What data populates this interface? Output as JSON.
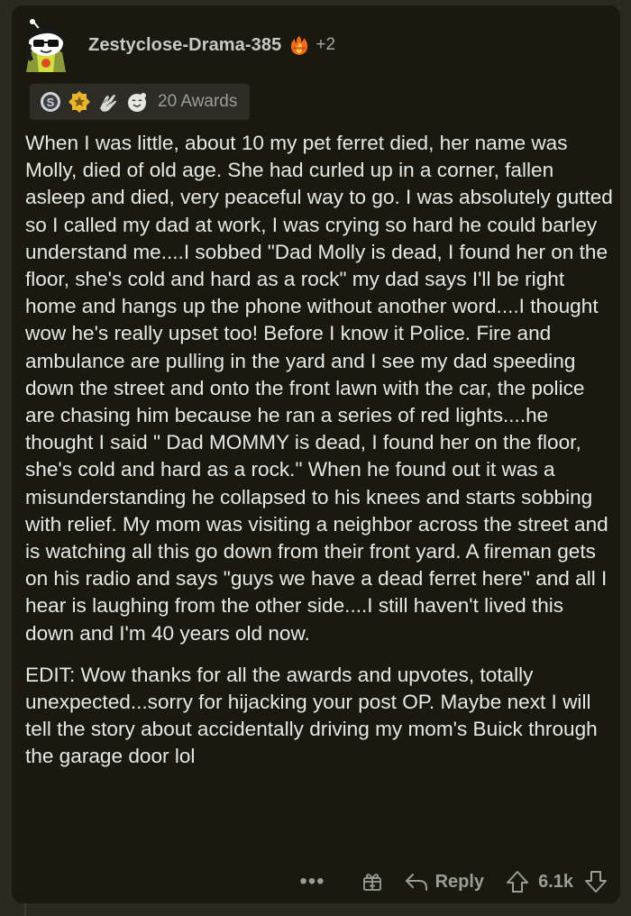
{
  "comment": {
    "username": "Zestyclose-Drama-385",
    "flair_icon": "fire-award-icon",
    "extra_flair_count": "+2",
    "awards": {
      "icons": [
        "silver-award-icon",
        "gold-award-icon",
        "hands-award-icon",
        "wholesome-award-icon"
      ],
      "label": "20 Awards"
    },
    "paragraphs": [
      "When I was little, about 10 my pet ferret died, her name was Molly, died of old age. She had curled up in a corner, fallen asleep and died, very peaceful way to go. I was absolutely gutted so I called my dad at work, I was crying so hard he could barley understand me....I sobbed \"Dad Molly is dead, I found her on the floor, she's cold and hard as a rock\" my dad says I'll be right home and hangs up the phone without another word....I thought wow he's really upset too! Before I know it Police. Fire and ambulance are pulling in the yard and I see my dad speeding down the street and onto the front lawn with the car, the police are chasing him because he ran a series of red lights....he thought I said \" Dad MOMMY is dead, I found her on the floor, she's cold and hard as a rock.\" When he found out it was a misunderstanding he collapsed to his knees and starts sobbing with relief. My mom was visiting a neighbor across the street and is watching all this go down from their front yard. A fireman gets on his radio and says \"guys we have a dead ferret here\" and all I hear is laughing from the other side....I still haven't lived this down and I'm 40 years old now.",
      "EDIT: Wow thanks for all the awards and upvotes, totally unexpected...sorry for hijacking your post OP. Maybe next I will tell the story about accidentally driving my mom's Buick through the garage door lol"
    ],
    "actions": {
      "more_label": "•••",
      "reply_label": "Reply",
      "score": "6.1k"
    }
  },
  "colors": {
    "page_background": "#2b2a1e",
    "card_background": "#1a190f",
    "text": "#e7e7e4",
    "muted": "#9d9d98"
  }
}
